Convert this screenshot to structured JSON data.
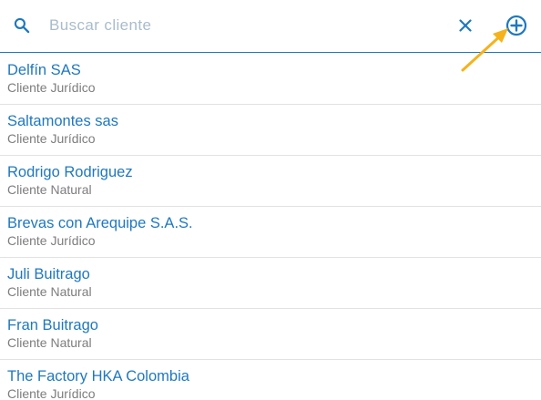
{
  "search": {
    "placeholder": "Buscar cliente",
    "value": ""
  },
  "icons": {
    "search": "search-icon",
    "clear": "close-icon",
    "add": "plus-circle-icon",
    "annotation": "arrow-icon"
  },
  "colors": {
    "accent": "#1f78bf",
    "arrow": "#f5b21b",
    "secondary_text": "#7d7d7d",
    "divider": "#e2e2e2"
  },
  "clients": [
    {
      "name": "Delfín SAS",
      "type": "Cliente Jurídico"
    },
    {
      "name": "Saltamontes sas",
      "type": "Cliente Jurídico"
    },
    {
      "name": "Rodrigo Rodriguez",
      "type": "Cliente Natural"
    },
    {
      "name": "Brevas con Arequipe S.A.S.",
      "type": "Cliente Jurídico"
    },
    {
      "name": "Juli Buitrago",
      "type": "Cliente Natural"
    },
    {
      "name": "Fran Buitrago",
      "type": "Cliente Natural"
    },
    {
      "name": "The Factory HKA Colombia",
      "type": "Cliente Jurídico"
    }
  ]
}
